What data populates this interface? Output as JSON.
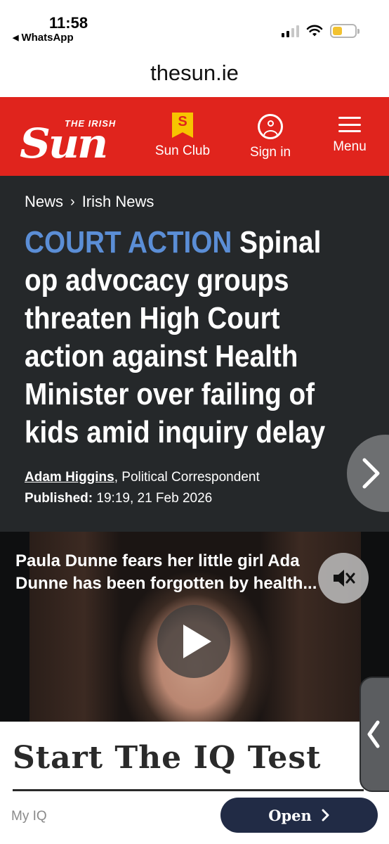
{
  "status_bar": {
    "time": "11:58",
    "back_app": "WhatsApp",
    "back_icon": "back-triangle-icon",
    "signal_bars_on": 2,
    "battery_level": 0.42,
    "battery_color": "#f2c230"
  },
  "browser": {
    "url": "thesun.ie"
  },
  "site_header": {
    "logo_small": "THE IRISH",
    "logo_main": "Sun",
    "club_badge_letter": "S",
    "sun_club_label": "Sun Club",
    "sign_in_label": "Sign in",
    "menu_label": "Menu",
    "background": "#e0241d"
  },
  "article": {
    "breadcrumb": [
      "News",
      "Irish News"
    ],
    "kicker": "COURT ACTION",
    "headline": "Spinal op advocacy groups threaten High Court action against Health Minister over failing of kids amid inquiry delay",
    "author": "Adam Higgins",
    "author_role": ", Political Correspondent",
    "published_label": "Published:",
    "published_value": "19:19, 21 Feb 2026",
    "kicker_color": "#5b8ed6"
  },
  "video": {
    "caption_line1": "Paula Dunne fears her little girl Ada",
    "caption_line2": "Dunne has been forgotten by health..."
  },
  "ad": {
    "title": "Start The IQ Test",
    "brand": "My IQ",
    "cta": "Open",
    "cta_icon": "chevron-right-icon"
  }
}
